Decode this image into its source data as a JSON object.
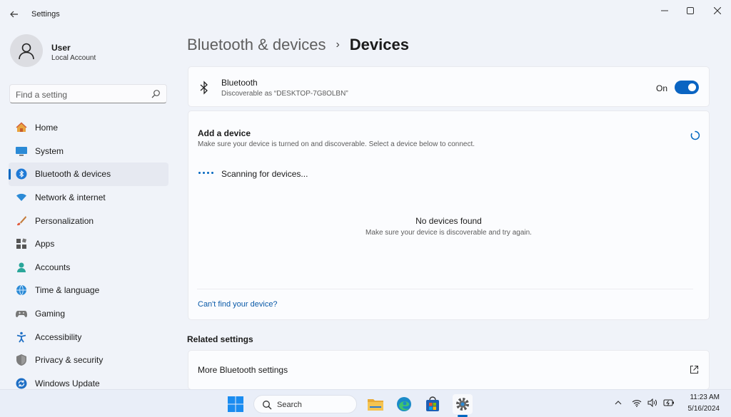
{
  "window": {
    "title": "Settings",
    "controls": {
      "minimize": "—",
      "maximize": "☐",
      "close": "✕"
    },
    "back_icon": "arrow-left"
  },
  "user": {
    "name": "User",
    "account_type": "Local Account"
  },
  "search": {
    "placeholder": "Find a setting"
  },
  "sidebar": {
    "items": [
      {
        "label": "Home",
        "icon": "home-icon",
        "active": false
      },
      {
        "label": "System",
        "icon": "system-icon",
        "active": false
      },
      {
        "label": "Bluetooth & devices",
        "icon": "bluetooth-icon",
        "active": true
      },
      {
        "label": "Network & internet",
        "icon": "wifi-icon",
        "active": false
      },
      {
        "label": "Personalization",
        "icon": "brush-icon",
        "active": false
      },
      {
        "label": "Apps",
        "icon": "apps-icon",
        "active": false
      },
      {
        "label": "Accounts",
        "icon": "person-icon",
        "active": false
      },
      {
        "label": "Time & language",
        "icon": "globe-icon",
        "active": false
      },
      {
        "label": "Gaming",
        "icon": "controller-icon",
        "active": false
      },
      {
        "label": "Accessibility",
        "icon": "accessibility-icon",
        "active": false
      },
      {
        "label": "Privacy & security",
        "icon": "shield-icon",
        "active": false
      },
      {
        "label": "Windows Update",
        "icon": "update-icon",
        "active": false
      }
    ]
  },
  "breadcrumb": {
    "parent": "Bluetooth & devices",
    "separator": "›",
    "current": "Devices"
  },
  "bluetooth_card": {
    "title": "Bluetooth",
    "subtitle": "Discoverable as “DESKTOP-7G8OLBN”",
    "toggle_label": "On",
    "toggle_on": true
  },
  "add_device": {
    "title": "Add a device",
    "subtitle": "Make sure your device is turned on and discoverable. Select a device below to connect.",
    "scanning_text": "Scanning for devices...",
    "no_devices_title": "No devices found",
    "no_devices_sub": "Make sure your device is discoverable and try again.",
    "help_link": "Can't find your device?"
  },
  "related": {
    "heading": "Related settings",
    "items": [
      {
        "label": "More Bluetooth settings",
        "icon": "external-link-icon"
      }
    ]
  },
  "taskbar": {
    "search_label": "Search",
    "apps": [
      "file-explorer-icon",
      "edge-icon",
      "store-icon",
      "settings-icon"
    ],
    "time": "11:23 AM",
    "date": "5/16/2024"
  },
  "colors": {
    "accent": "#0067c0",
    "link": "#0a5aa8",
    "toggle": "#0a64c2"
  }
}
